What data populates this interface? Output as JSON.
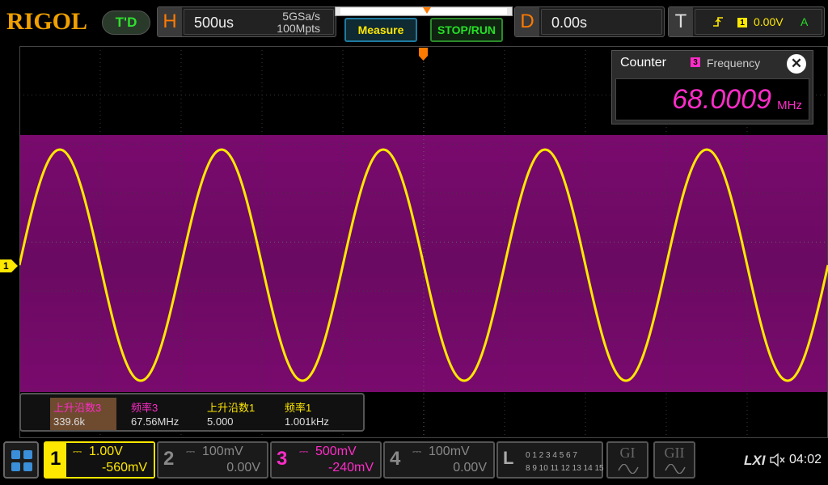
{
  "brand": {
    "logo": "RIGOL",
    "mode_badge": "T'D"
  },
  "horizontal": {
    "letter": "H",
    "timebase": "500us",
    "sample_rate": "5GSa/s",
    "memory_depth": "100Mpts"
  },
  "buttons": {
    "measure": "Measure",
    "stop_run": "STOP/RUN"
  },
  "delay": {
    "letter": "D",
    "value": "0.00s"
  },
  "trigger": {
    "letter": "T",
    "source_badge": "1",
    "level": "0.00V",
    "mode": "A"
  },
  "counter": {
    "title": "Counter",
    "source_badge": "3",
    "source_label": "Frequency",
    "close_glyph": "✕",
    "value": "68.0009",
    "unit": "MHz"
  },
  "ch1_marker": "1",
  "measurements": [
    {
      "label": "上升沿数3",
      "value": "339.6k",
      "color": "#ff2cc8"
    },
    {
      "label": "频率3",
      "value": "67.56MHz",
      "color": "#ff2cc8"
    },
    {
      "label": "上升沿数1",
      "value": "5.000",
      "color": "#ffe800"
    },
    {
      "label": "频率1",
      "value": "1.001kHz",
      "color": "#ffe800"
    }
  ],
  "channels": [
    {
      "num": "1",
      "coupling": "⎓",
      "scale": "1.00V",
      "offset": "-560mV"
    },
    {
      "num": "2",
      "coupling": "⎓",
      "scale": "100mV",
      "offset": "0.00V"
    },
    {
      "num": "3",
      "coupling": "⎓",
      "scale": "500mV",
      "offset": "-240mV"
    },
    {
      "num": "4",
      "coupling": "⎓",
      "scale": "100mV",
      "offset": "0.00V"
    }
  ],
  "logic": {
    "letter": "L",
    "row1": "0 1 2 3  4 5 6 7",
    "row2": "8 9 10 11 12 13 14 15"
  },
  "generators": {
    "g1": "GI",
    "g2": "GII"
  },
  "status": {
    "lxi": "LXI",
    "clock": "04:02"
  },
  "colors": {
    "ch1": "#ffe800",
    "ch3": "#ff2cc8",
    "accent": "#ff7a00"
  }
}
